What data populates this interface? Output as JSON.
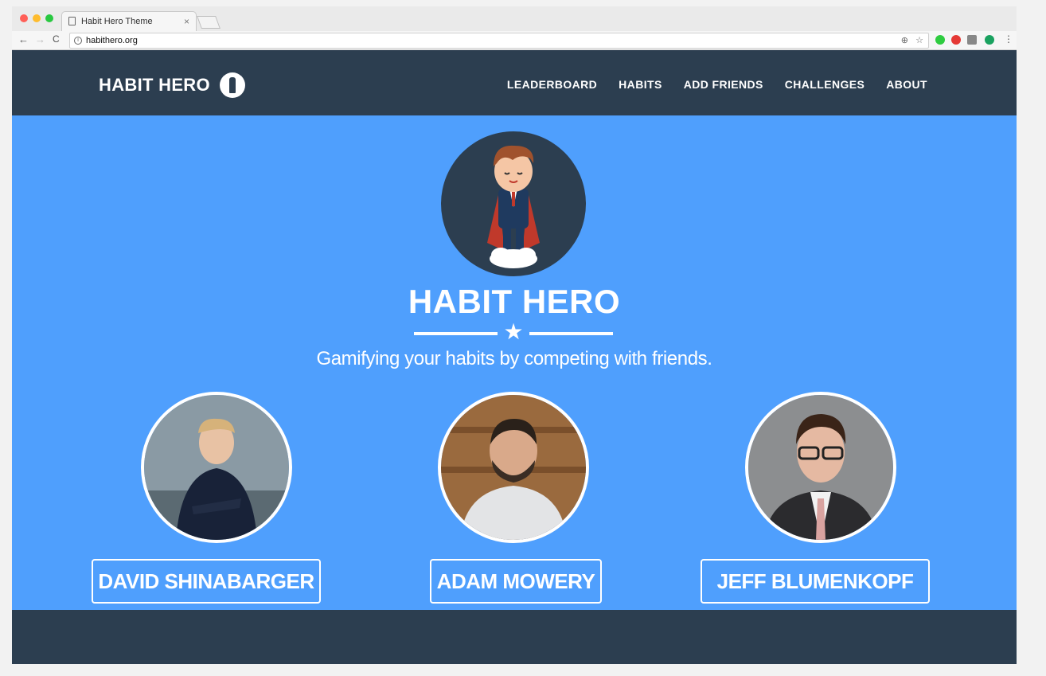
{
  "browser": {
    "tab_title": "Habit Hero Theme",
    "tab_close": "×",
    "url": "habithero.org",
    "back": "←",
    "forward": "→",
    "reload": "C",
    "zoom_icon": "⊕",
    "bookmark_icon": "☆",
    "menu_icon": "⋮"
  },
  "header": {
    "logo_text": "HABIT HERO",
    "nav": [
      "LEADERBOARD",
      "HABITS",
      "ADD FRIENDS",
      "CHALLENGES",
      "ABOUT"
    ]
  },
  "hero": {
    "title": "HABIT HERO",
    "star": "★",
    "tagline": "Gamifying your habits by competing with friends."
  },
  "team": [
    {
      "name": "DAVID SHINABARGER"
    },
    {
      "name": "ADAM MOWERY"
    },
    {
      "name": "JEFF BLUMENKOPF"
    }
  ],
  "colors": {
    "navy": "#2c3e50",
    "hero_blue": "#4f9ffd",
    "white": "#ffffff"
  }
}
